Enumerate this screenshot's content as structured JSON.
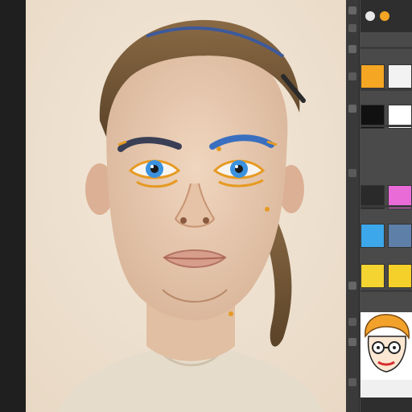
{
  "app": {
    "panel_icons": [
      "brush-tool-icon",
      "eraser-tool-icon",
      "eyedropper-tool-icon",
      "layers-icon",
      "color-picker-icon",
      "zoom-icon",
      "hand-tool-icon",
      "move-tool-icon"
    ]
  },
  "palette": {
    "colors": [
      {
        "name": "orange",
        "hex": "#F5A623"
      },
      {
        "name": "white",
        "hex": "#F2F2F2"
      },
      {
        "name": "black",
        "hex": "#111111"
      },
      {
        "name": "white-2",
        "hex": "#FFFFFF"
      },
      {
        "name": "dark-gray",
        "hex": "#2A2A2A"
      },
      {
        "name": "magenta",
        "hex": "#E86BD8"
      },
      {
        "name": "sky-blue",
        "hex": "#3CA7EA"
      },
      {
        "name": "steel-blue",
        "hex": "#5E7FA8"
      },
      {
        "name": "yellow",
        "hex": "#F4D431"
      },
      {
        "name": "yellow-2",
        "hex": "#F6D02A"
      }
    ]
  },
  "canvas": {
    "background": "#EFE3D2",
    "hair_color": "#6B5132",
    "skin_color": "#E7C9AE",
    "eye_color": "#2F8FE0",
    "accent_orange": "#E69A22",
    "shirt_color": "#E8DFCF"
  },
  "preview": {
    "icon": "cartoon-face-thumbnail"
  }
}
